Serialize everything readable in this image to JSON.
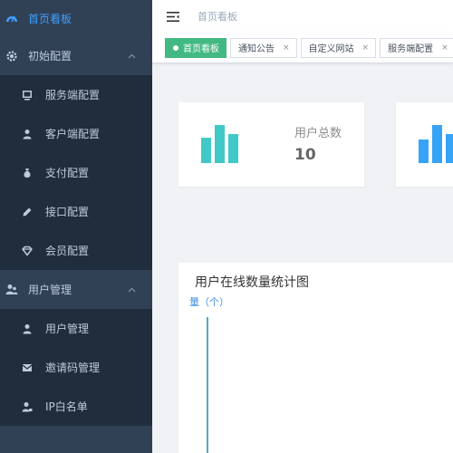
{
  "sidebar": {
    "home": {
      "label": "首页看板",
      "icon": "dashboard-icon"
    },
    "groups": [
      {
        "label": "初始配置",
        "icon": "settings-icon",
        "items": [
          {
            "label": "服务端配置",
            "icon": "monitor-icon"
          },
          {
            "label": "客户端配置",
            "icon": "user-icon"
          },
          {
            "label": "支付配置",
            "icon": "money-bag-icon"
          },
          {
            "label": "接口配置",
            "icon": "pencil-icon"
          },
          {
            "label": "会员配置",
            "icon": "diamond-icon"
          }
        ]
      },
      {
        "label": "用户管理",
        "icon": "users-icon",
        "items": [
          {
            "label": "用户管理",
            "icon": "user-icon"
          },
          {
            "label": "邀请码管理",
            "icon": "envelope-icon"
          },
          {
            "label": "IP白名单",
            "icon": "user-lock-icon"
          }
        ]
      }
    ]
  },
  "header": {
    "breadcrumb": "首页看板"
  },
  "tags": [
    {
      "label": "首页看板",
      "active": true
    },
    {
      "label": "通知公告",
      "close": "×"
    },
    {
      "label": "自定义网站",
      "close": "×"
    },
    {
      "label": "服务端配置",
      "close": "×"
    }
  ],
  "cards": [
    {
      "label": "用户总数",
      "value": "10",
      "color": "#40c9c6"
    },
    {
      "color": "#36a3f7"
    }
  ],
  "chart_panel": {
    "title": "用户在线数量统计图",
    "axis_name": "量（个）"
  },
  "colors": {
    "sidebar_bg": "#304156",
    "submenu_bg": "#1f2d3d",
    "active": "#409eff",
    "tag_active": "#42b983"
  }
}
